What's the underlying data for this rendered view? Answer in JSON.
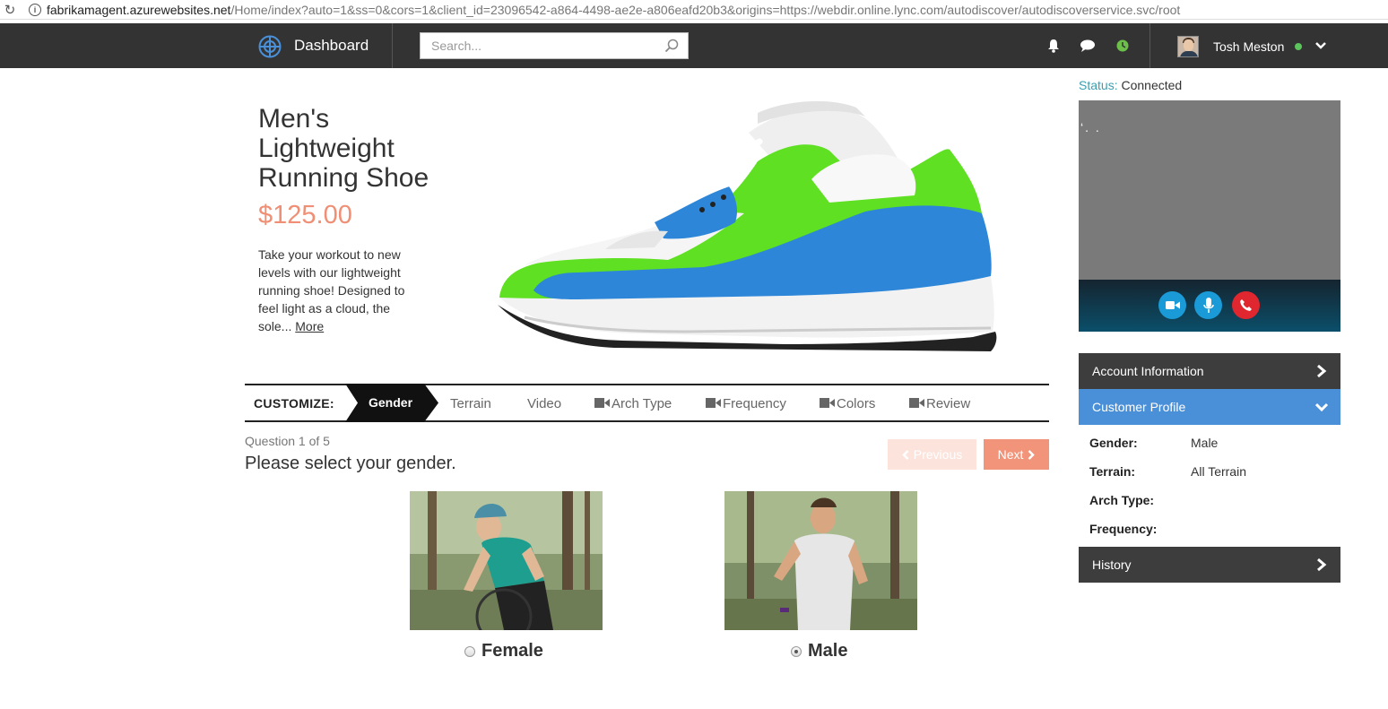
{
  "browser": {
    "url_host": "fabrikamagent.azurewebsites.net",
    "url_path": "/Home/index?auto=1&ss=0&cors=1&client_id=23096542-a864-4498-ae2e-a806eafd20b3&origins=https://webdir.online.lync.com/autodiscover/autodiscoverservice.svc/root"
  },
  "header": {
    "title": "Dashboard",
    "search_placeholder": "Search...",
    "user_name": "Tosh Meston",
    "icons": [
      "bell-icon",
      "chat-icon",
      "clock-icon"
    ]
  },
  "product": {
    "title": "Men's Lightweight Running Shoe",
    "price": "$125.00",
    "description": "Take your workout to new levels with our lightweight running shoe! Designed to feel light as a cloud, the sole...",
    "more_label": "More"
  },
  "customize": {
    "label": "CUSTOMIZE:",
    "steps": [
      {
        "label": "Gender",
        "active": true,
        "icon": ""
      },
      {
        "label": "Terrain",
        "active": false,
        "icon": ""
      },
      {
        "label": "Video",
        "active": false,
        "icon": ""
      },
      {
        "label": "Arch Type",
        "active": false,
        "icon": "camera-icon"
      },
      {
        "label": "Frequency",
        "active": false,
        "icon": "camera-icon"
      },
      {
        "label": "Colors",
        "active": false,
        "icon": "camera-icon"
      },
      {
        "label": "Review",
        "active": false,
        "icon": "camera-icon"
      }
    ]
  },
  "question": {
    "number": "Question 1 of 5",
    "text": "Please select your gender.",
    "prev_label": "Previous",
    "next_label": "Next",
    "options": [
      {
        "label": "Female",
        "selected": false
      },
      {
        "label": "Male",
        "selected": true
      }
    ]
  },
  "sidebar": {
    "status_label": "Status:",
    "status_value": "Connected",
    "account_label": "Account Information",
    "profile_label": "Customer Profile",
    "history_label": "History",
    "profile": [
      {
        "key": "Gender:",
        "value": "Male"
      },
      {
        "key": "Terrain:",
        "value": "All Terrain"
      },
      {
        "key": "Arch Type:",
        "value": ""
      },
      {
        "key": "Frequency:",
        "value": ""
      }
    ]
  },
  "colors": {
    "accent": "#f29479",
    "price": "#ef8f75",
    "nav_bg": "#333333",
    "profile_header": "#4a90d9",
    "online": "#5cc45c"
  }
}
